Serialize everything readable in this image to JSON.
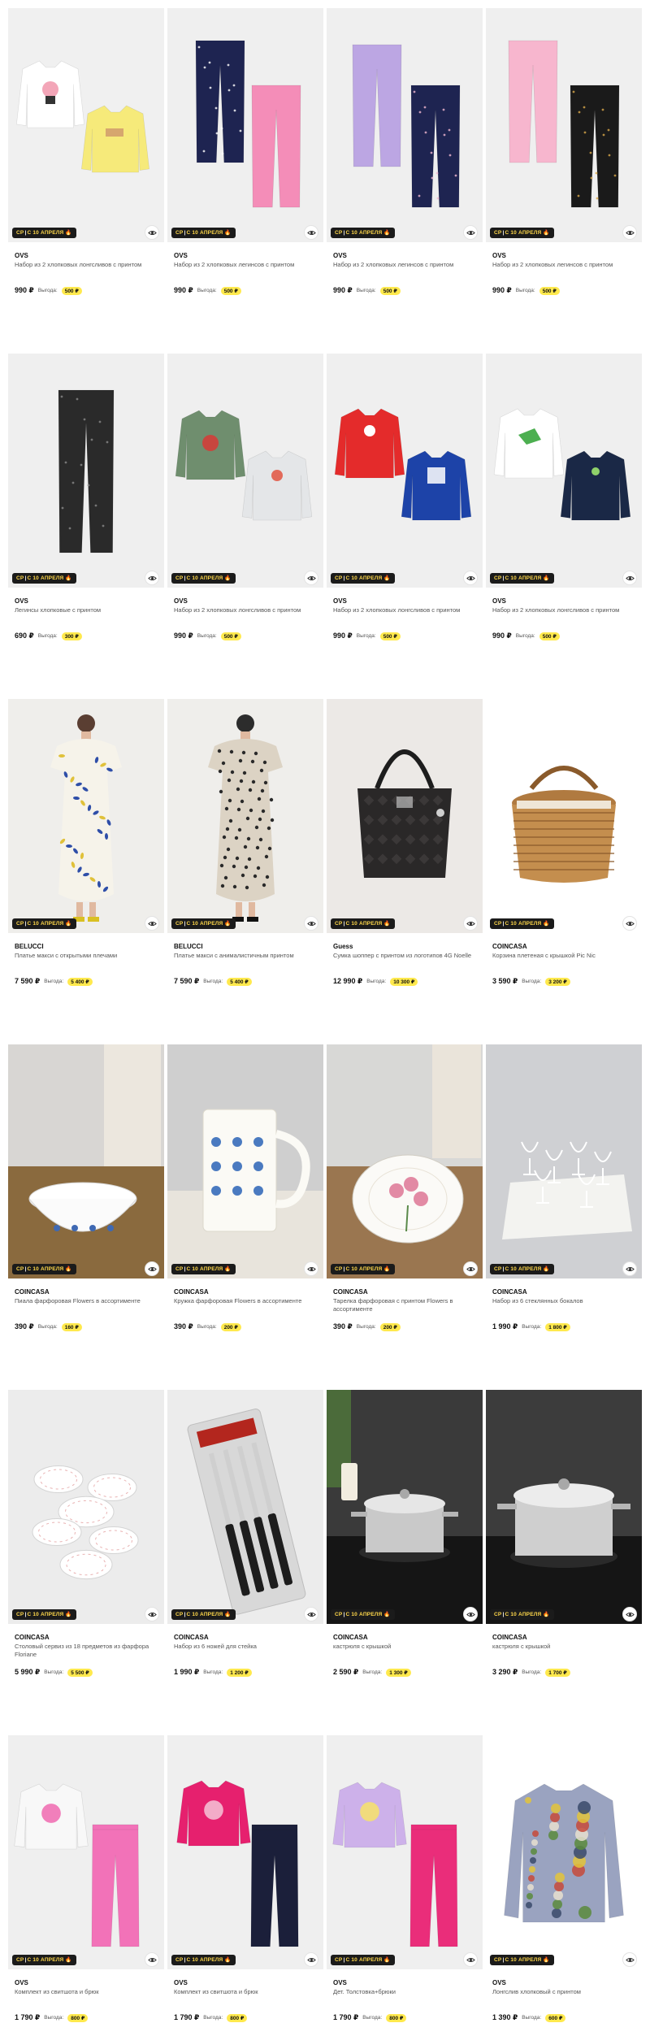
{
  "promo_badge": {
    "left": "СР",
    "sep": "|",
    "right": "С 10 АПРЕЛЯ",
    "flame": "🔥"
  },
  "benefit_label": "Выгода:",
  "products": [
    {
      "brand": "OVS",
      "title": "Набор из 2 хлопковых лонгсливов с принтом",
      "price": "990 ₽",
      "benefit": "500 ₽",
      "illustration": "two-longsleeves-white-yellow"
    },
    {
      "brand": "OVS",
      "title": "Набор из 2 хлопковых легинсов с принтом",
      "price": "990 ₽",
      "benefit": "500 ₽",
      "illustration": "leggings-navy-pink"
    },
    {
      "brand": "OVS",
      "title": "Набор из 2 хлопковых легинсов с принтом",
      "price": "990 ₽",
      "benefit": "500 ₽",
      "illustration": "leggings-lilac-navy"
    },
    {
      "brand": "OVS",
      "title": "Набор из 2 хлопковых легинсов с принтом",
      "price": "990 ₽",
      "benefit": "500 ₽",
      "illustration": "leggings-pink-black"
    },
    {
      "brand": "OVS",
      "title": "Легинсы хлопковые с принтом",
      "price": "690 ₽",
      "benefit": "300 ₽",
      "illustration": "leggings-black-single"
    },
    {
      "brand": "OVS",
      "title": "Набор из 2 хлопковых лонгсливов с принтом",
      "price": "990 ₽",
      "benefit": "500 ₽",
      "illustration": "longsleeves-green-grey"
    },
    {
      "brand": "OVS",
      "title": "Набор из 2 хлопковых лонгсливов с принтом",
      "price": "990 ₽",
      "benefit": "500 ₽",
      "illustration": "longsleeves-red-blue"
    },
    {
      "brand": "OVS",
      "title": "Набор из 2 хлопковых лонгсливов с принтом",
      "price": "990 ₽",
      "benefit": "500 ₽",
      "illustration": "longsleeves-white-navy"
    },
    {
      "brand": "BELUCCI",
      "title": "Платье макси с открытыми плечами",
      "price": "7 590 ₽",
      "benefit": "5 400 ₽",
      "illustration": "dress-white-floral"
    },
    {
      "brand": "BELUCCI",
      "title": "Платье макси с анималистичным принтом",
      "price": "7 590 ₽",
      "benefit": "5 400 ₽",
      "illustration": "dress-leopard"
    },
    {
      "brand": "Guess",
      "title": "Сумка шоппер с принтом из логотипов 4G Noelle",
      "price": "12 990 ₽",
      "benefit": "10 300 ₽",
      "illustration": "bag-black"
    },
    {
      "brand": "COINCASA",
      "title": "Корзина плетеная с крышкой Pic Nic",
      "price": "3 590 ₽",
      "benefit": "3 200 ₽",
      "illustration": "picnic-basket"
    },
    {
      "brand": "COINCASA",
      "title": "Пиала фарфоровая Flowers в ассортименте",
      "price": "390 ₽",
      "benefit": "160 ₽",
      "illustration": "bowl"
    },
    {
      "brand": "COINCASA",
      "title": "Кружка фарфоровая Flowers в ассортименте",
      "price": "390 ₽",
      "benefit": "200 ₽",
      "illustration": "mug"
    },
    {
      "brand": "COINCASA",
      "title": "Тарелка фарфоровая с принтом Flowers в ассортименте",
      "price": "390 ₽",
      "benefit": "200 ₽",
      "illustration": "plate"
    },
    {
      "brand": "COINCASA",
      "title": "Набор из 6 стеклянных бокалов",
      "price": "1 990 ₽",
      "benefit": "1 800 ₽",
      "illustration": "glasses"
    },
    {
      "brand": "COINCASA",
      "title": "Столовый сервиз из 18 предметов из фарфора Floriane",
      "price": "5 990 ₽",
      "benefit": "5 500 ₽",
      "illustration": "dinner-set"
    },
    {
      "brand": "COINCASA",
      "title": "Набор из 6 ножей для стейка",
      "price": "1 990 ₽",
      "benefit": "1 200 ₽",
      "illustration": "knives"
    },
    {
      "brand": "COINCASA",
      "title": "кастрюля с крышкой",
      "price": "2 590 ₽",
      "benefit": "1 300 ₽",
      "illustration": "pot-small"
    },
    {
      "brand": "COINCASA",
      "title": "кастрюля с крышкой",
      "price": "3 290 ₽",
      "benefit": "1 700 ₽",
      "illustration": "pot-large"
    },
    {
      "brand": "OVS",
      "title": "Комплект из свитшота и брюк",
      "price": "1 790 ₽",
      "benefit": "800 ₽",
      "illustration": "set-white-pink"
    },
    {
      "brand": "OVS",
      "title": "Комплект из свитшота и брюк",
      "price": "1 790 ₽",
      "benefit": "800 ₽",
      "illustration": "set-pink-navy"
    },
    {
      "brand": "OVS",
      "title": "Дет. Толстовка+брюки",
      "price": "1 790 ₽",
      "benefit": "800 ₽",
      "illustration": "set-lilac-pink"
    },
    {
      "brand": "OVS",
      "title": "Лонгслив хлопковый с принтом",
      "price": "1 390 ₽",
      "benefit": "600 ₽",
      "illustration": "longsleeve-printed"
    }
  ]
}
